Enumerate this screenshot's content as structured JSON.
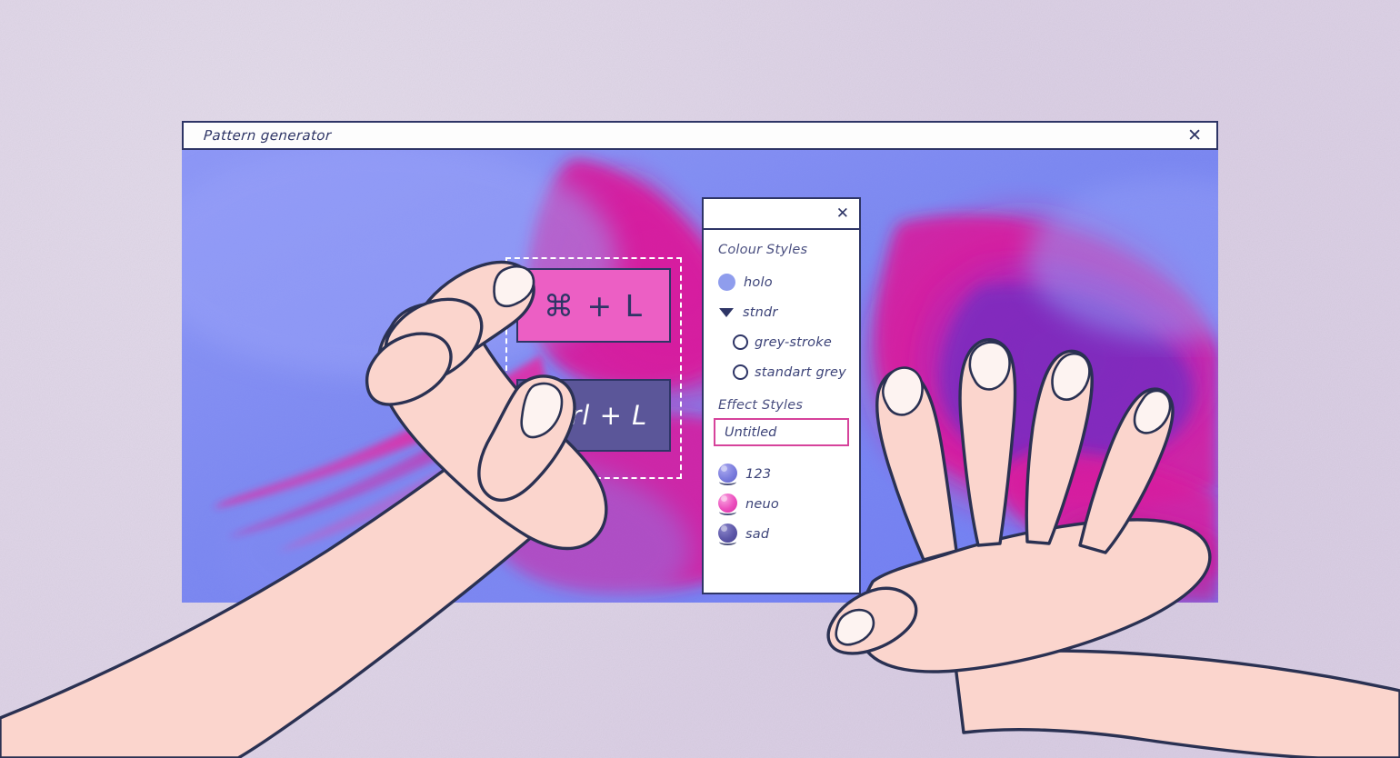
{
  "window": {
    "title": "Pattern generator",
    "close_label": "✕"
  },
  "canvas": {
    "selection": {
      "cards": [
        {
          "id": "cmd",
          "label": "⌘ + L",
          "bg": "#ec5fc4",
          "fg": "#2e3566"
        },
        {
          "id": "ctrl",
          "label": "Ctrl + L",
          "bg": "#5b5699",
          "fg": "#ffffff"
        }
      ]
    }
  },
  "styles_panel": {
    "close_label": "✕",
    "colour_section": {
      "title": "Colour Styles",
      "items": [
        {
          "label": "holo",
          "marker": "filled-circle",
          "color": "#8f9ded",
          "indent": false
        },
        {
          "label": "stndr",
          "marker": "triangle-down",
          "color": "#2e3566",
          "indent": false
        },
        {
          "label": "grey-stroke",
          "marker": "ring",
          "color": "#2e3566",
          "indent": true
        },
        {
          "label": "standart grey",
          "marker": "ring",
          "color": "#2e3566",
          "indent": true
        }
      ]
    },
    "effect_section": {
      "title": "Effect Styles",
      "name_input": {
        "value": "Untitled",
        "placeholder": "Untitled",
        "border_color": "#d6439b"
      },
      "items": [
        {
          "label": "123",
          "marker": "sphere",
          "color": "#7b7ddd"
        },
        {
          "label": "neuo",
          "marker": "sphere",
          "color": "#ec4fbe"
        },
        {
          "label": "sad",
          "marker": "sphere",
          "color": "#5d57a8"
        }
      ]
    }
  },
  "palette": {
    "page_bg": "#ddd2e6",
    "ink": "#2e3566",
    "canvas_blue": "#7a86f0",
    "canvas_magenta": "#d61f9e",
    "canvas_purple": "#7d2bbd",
    "skin": "#fbd5cd",
    "nail": "#fdf3f1",
    "accent_pink": "#d6439b"
  }
}
